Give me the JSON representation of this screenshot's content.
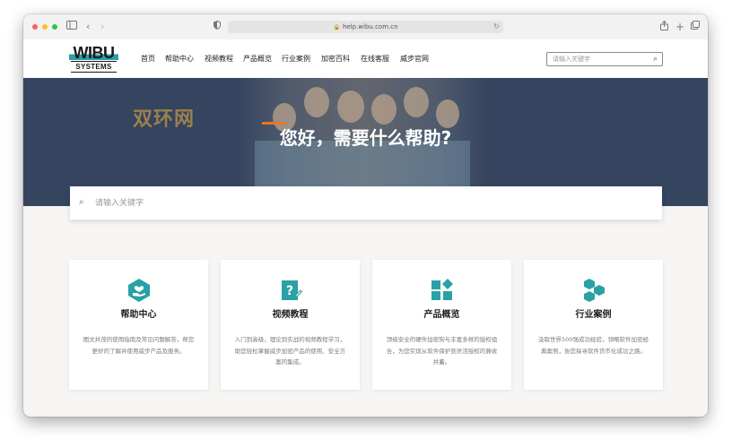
{
  "browser": {
    "url": "help.wibu.com.cn"
  },
  "logo": {
    "top_text": "WIBU",
    "bottom_text": "SYSTEMS"
  },
  "nav": {
    "items": [
      {
        "label": "首页"
      },
      {
        "label": "帮助中心"
      },
      {
        "label": "视频教程"
      },
      {
        "label": "产品概览"
      },
      {
        "label": "行业案例"
      },
      {
        "label": "加密百科"
      },
      {
        "label": "在线客服"
      },
      {
        "label": "威步官网"
      }
    ],
    "search_placeholder": "请输入关键字"
  },
  "hero": {
    "title": "您好，需要什么帮助?",
    "watermark": "双环网",
    "search_placeholder": "请输入关键字"
  },
  "cards": [
    {
      "title": "帮助中心",
      "desc": "图文并茂的使用指南及常见问题解答，帮您更好的了解并使用威步产品及服务。",
      "icon": "heart-hand-icon"
    },
    {
      "title": "视频教程",
      "desc": "入门到高级，理论到实战的视频教程学习，助您轻松掌握威步加密产品的使用、安全方案的集成。",
      "icon": "help-document-icon"
    },
    {
      "title": "产品概览",
      "desc": "顶级安全的硬件加密狗与丰富多样的授权组合，为您实现从软件保护到灵活授权的兼收并蓄。",
      "icon": "product-grid-icon"
    },
    {
      "title": "行业案例",
      "desc": "汲取世界500强成功经验，领略软件加密经典案例，协您探寻软件货币化成功之路。",
      "icon": "hexagon-cluster-icon"
    }
  ],
  "colors": {
    "accent_teal": "#2aa1a6",
    "hero_bg": "#35445f",
    "accent_orange": "#e87722"
  }
}
